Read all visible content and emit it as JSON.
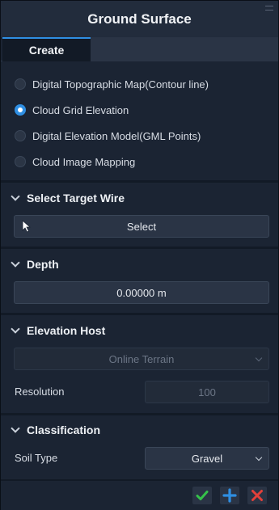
{
  "window": {
    "title": "Ground Surface"
  },
  "tabs": [
    {
      "label": "Create"
    }
  ],
  "source_options": [
    {
      "label": "Digital Topographic Map(Contour line)",
      "checked": false
    },
    {
      "label": "Cloud Grid Elevation",
      "checked": true
    },
    {
      "label": "Digital Elevation Model(GML Points)",
      "checked": false
    },
    {
      "label": "Cloud Image Mapping",
      "checked": false
    }
  ],
  "select_target_wire": {
    "title": "Select Target Wire",
    "button_label": "Select",
    "icon": "cursor-arrow-icon"
  },
  "depth": {
    "title": "Depth",
    "value": "0.00000 m"
  },
  "elevation_host": {
    "title": "Elevation Host",
    "host_value": "Online Terrain",
    "resolution_label": "Resolution",
    "resolution_value": "100"
  },
  "classification": {
    "title": "Classification",
    "soil_type_label": "Soil Type",
    "soil_type_value": "Gravel"
  },
  "footer": {
    "actions": [
      {
        "name": "confirm",
        "icon": "check-icon",
        "color": "#35c24a"
      },
      {
        "name": "add",
        "icon": "plus-icon",
        "color": "#2f8fe3"
      },
      {
        "name": "cancel",
        "icon": "close-icon",
        "color": "#e2403a"
      }
    ]
  },
  "colors": {
    "accent": "#2f8fe3",
    "panel_bg": "#1b2433"
  }
}
